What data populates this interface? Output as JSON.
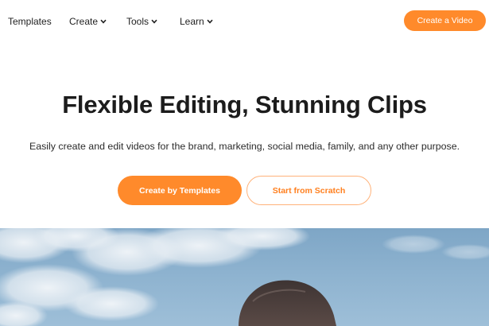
{
  "nav": {
    "items": [
      {
        "label": "Templates",
        "has_dropdown": false
      },
      {
        "label": "Create",
        "has_dropdown": true
      },
      {
        "label": "Tools",
        "has_dropdown": true
      },
      {
        "label": "Learn",
        "has_dropdown": true
      }
    ],
    "cta_label": "Create a Video"
  },
  "hero": {
    "title": "Flexible Editing, Stunning Clips",
    "subtitle": "Easily create and edit videos for the brand, marketing, social media, family, and any other purpose.",
    "primary_button": "Create by Templates",
    "secondary_button": "Start from Scratch"
  },
  "colors": {
    "accent": "#ff8a2b",
    "text": "#1c1c1c",
    "sky": "#8db2cf"
  },
  "banner": {
    "icon": "sky-clouds-photo"
  }
}
